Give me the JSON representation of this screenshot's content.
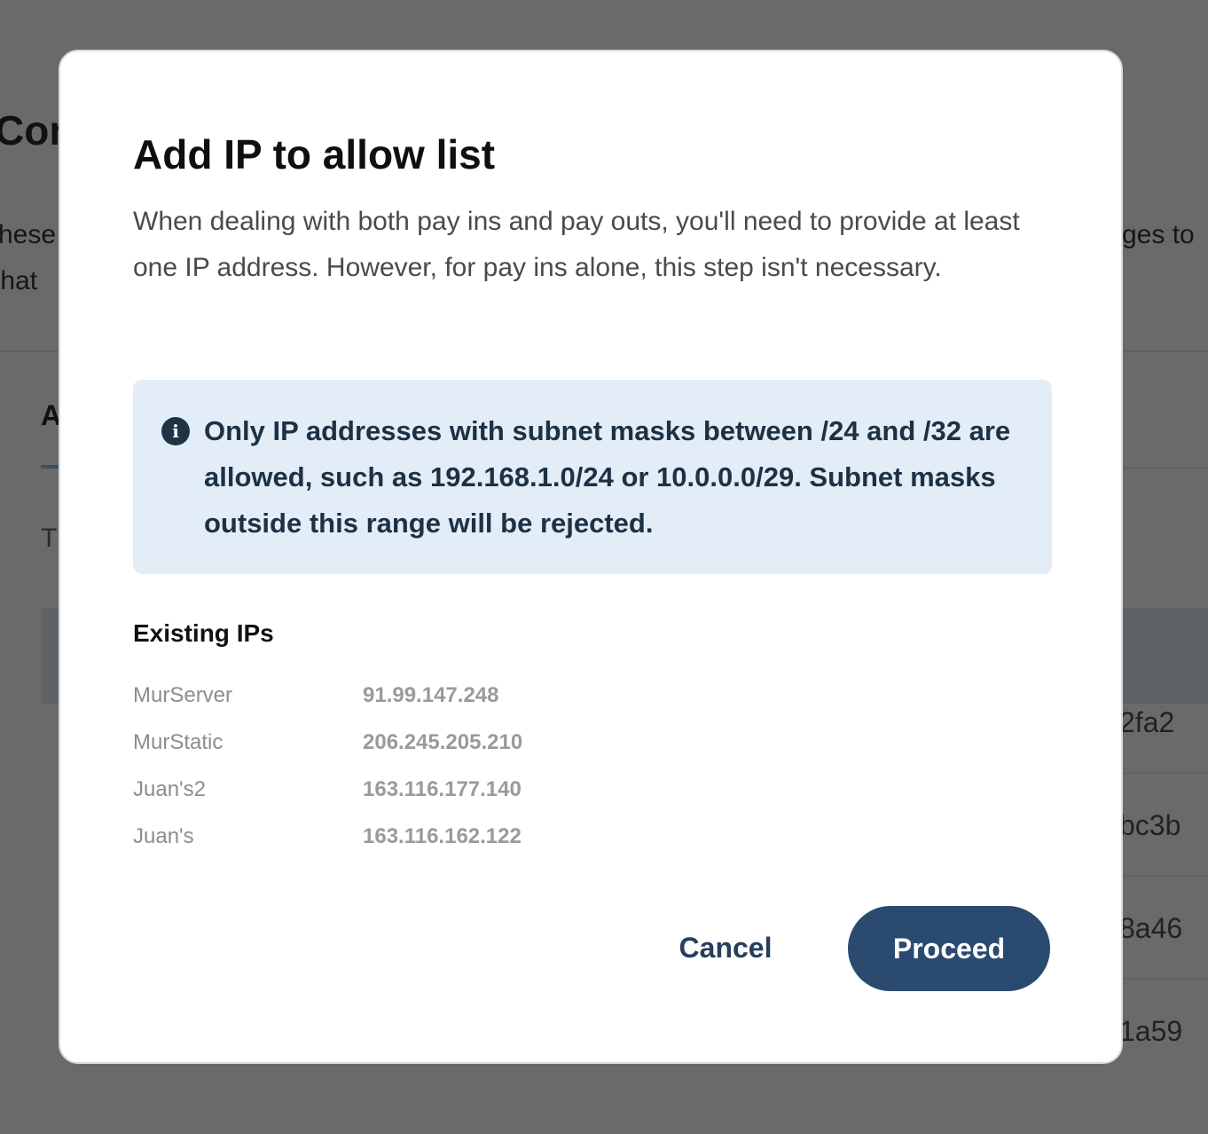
{
  "background": {
    "title_fragment": "Con",
    "description_left_line1": "hese",
    "description_left_line2": "that",
    "description_right_line1": "ges to",
    "tab_fragment": "A",
    "subtext_fragment": "T",
    "cells": [
      "2fa2",
      "bc3b",
      "8a46",
      "1a59"
    ]
  },
  "modal": {
    "title": "Add IP to allow list",
    "description": "When dealing with both pay ins and pay outs, you'll need to provide at least one IP address. However, for pay ins alone, this step isn't necessary.",
    "info": {
      "icon": "info-icon",
      "icon_glyph": "i",
      "text": "Only IP addresses with subnet masks between /24 and /32 are allowed, such as 192.168.1.0/24 or 10.0.0.0/29. Subnet masks outside this range will be rejected."
    },
    "existing_ips": {
      "title": "Existing IPs",
      "items": [
        {
          "name": "MurServer",
          "ip": "91.99.147.248"
        },
        {
          "name": "MurStatic",
          "ip": "206.245.205.210"
        },
        {
          "name": "Juan's2",
          "ip": "163.116.177.140"
        },
        {
          "name": "Juan's",
          "ip": "163.116.162.122"
        }
      ]
    },
    "buttons": {
      "cancel_label": "Cancel",
      "proceed_label": "Proceed"
    }
  },
  "colors": {
    "overlay": "#6a6a6a",
    "info_background": "#e3edf7",
    "primary": "#2b4a6f",
    "info_text": "#1d3144"
  }
}
